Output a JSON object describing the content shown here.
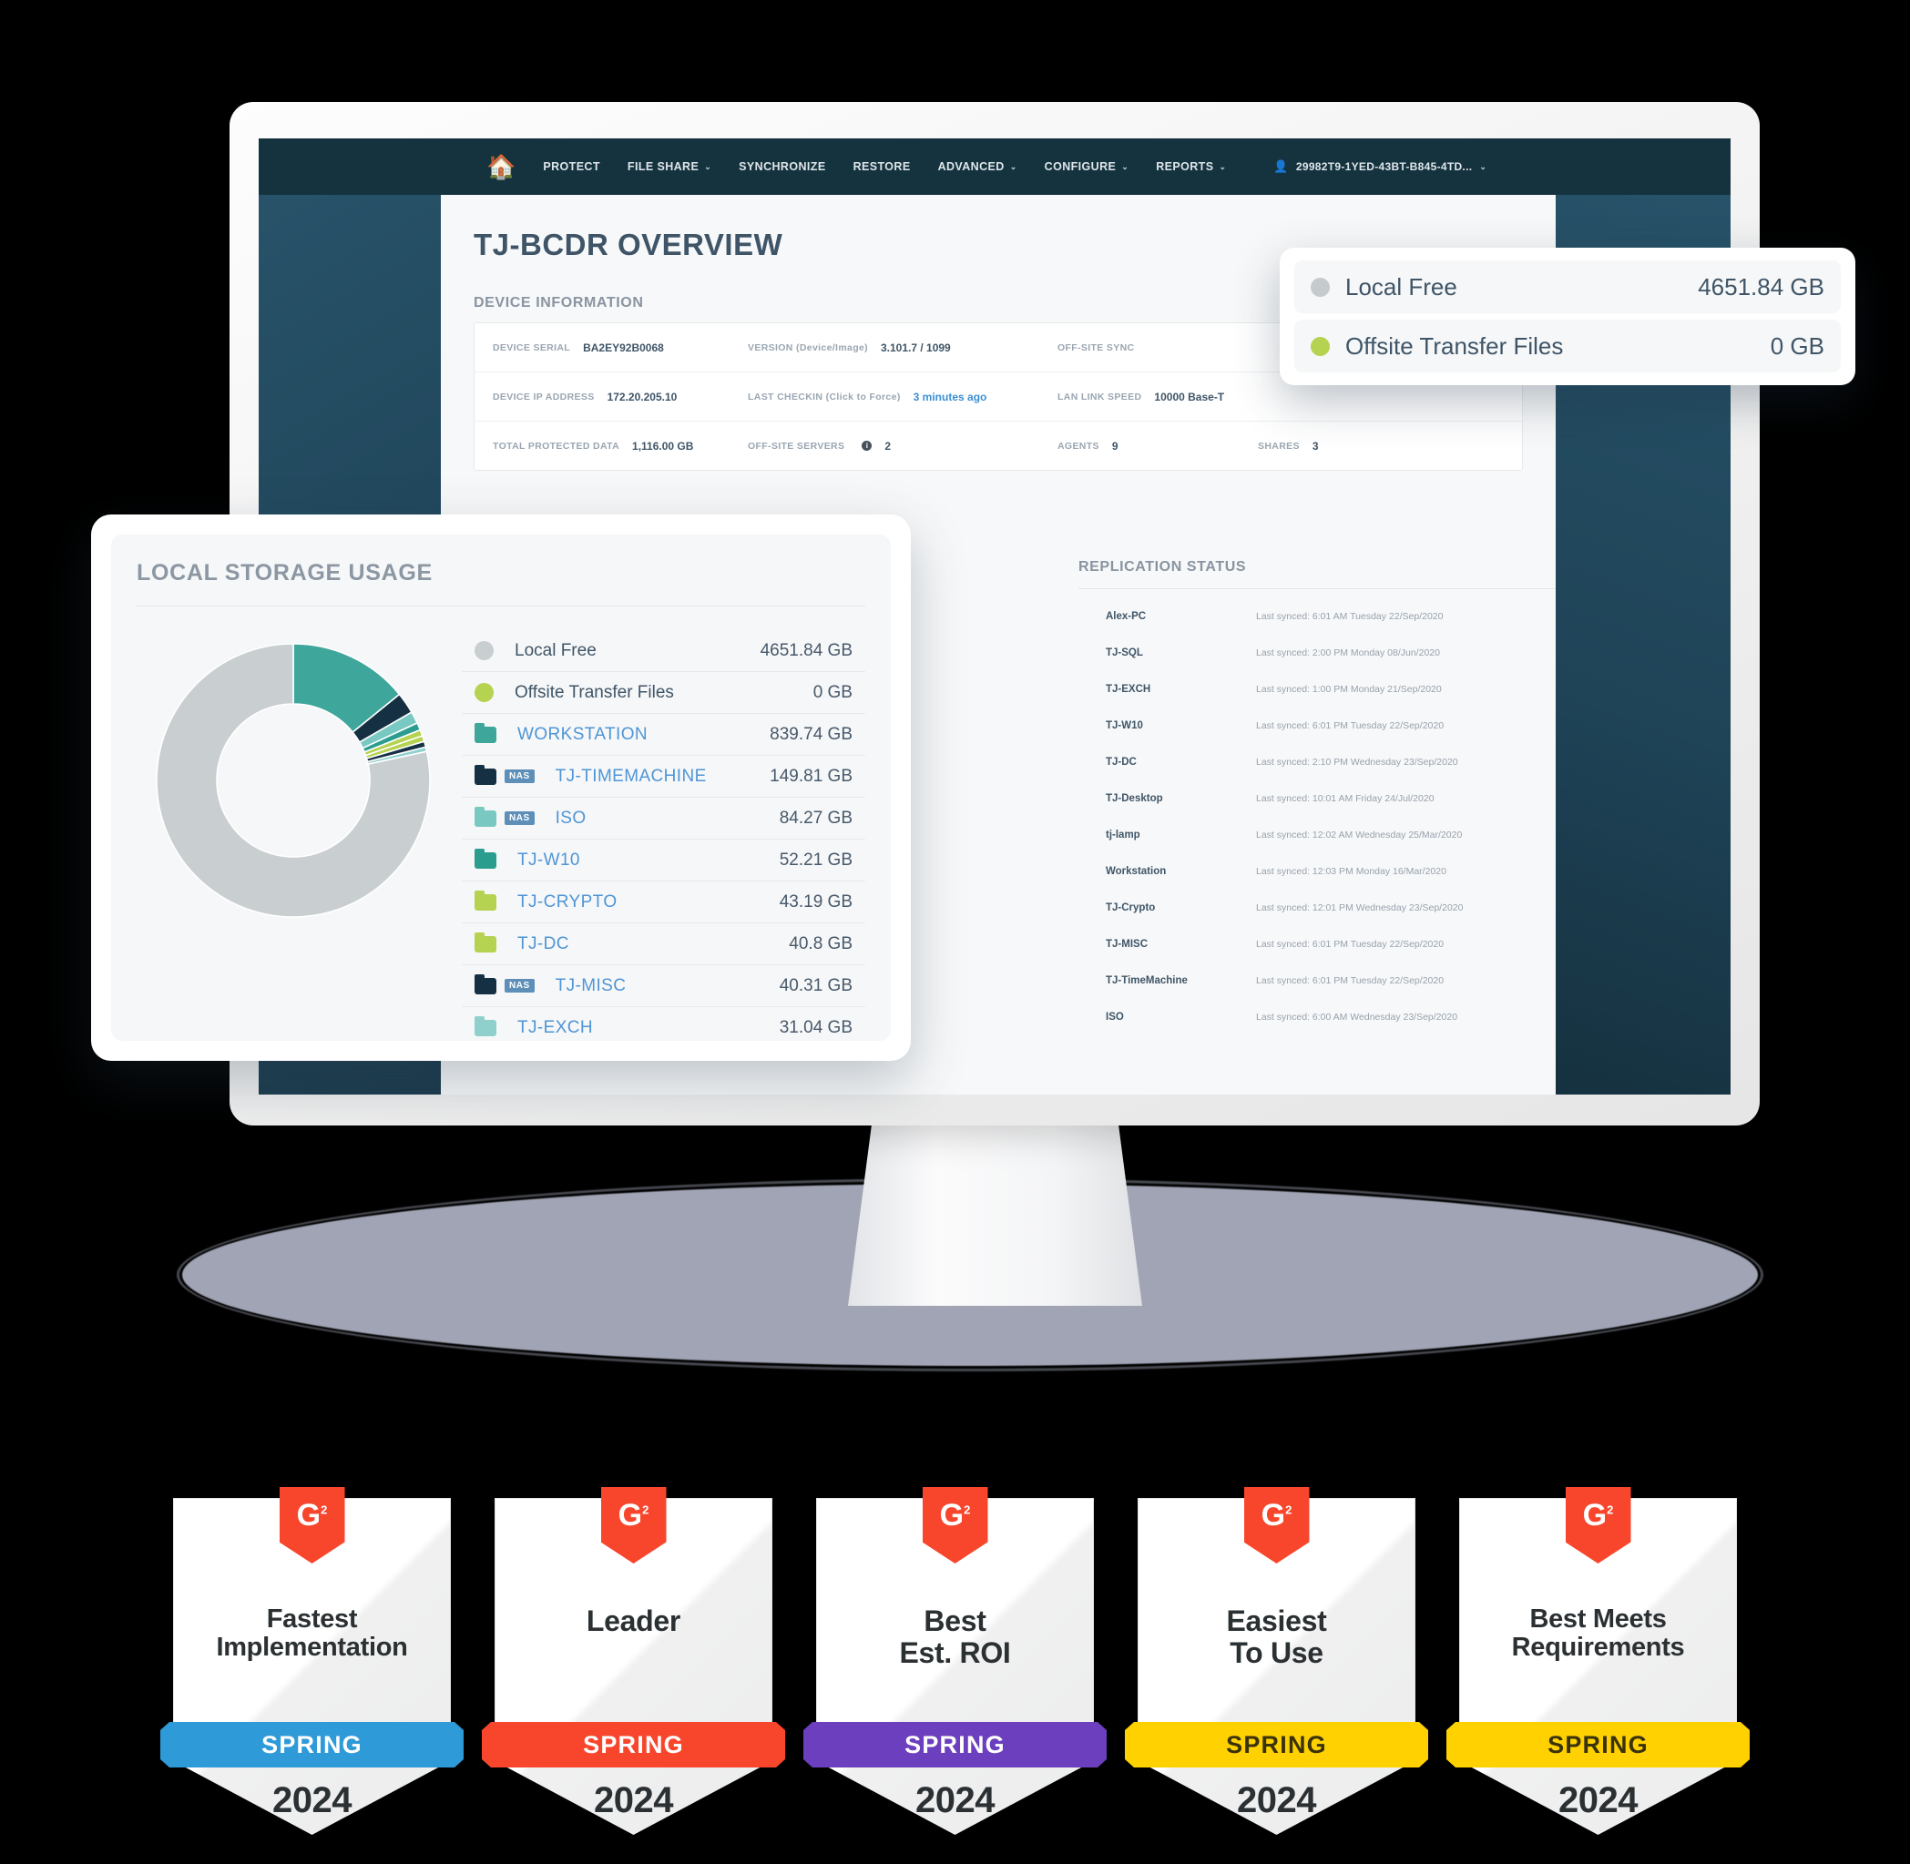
{
  "app": {
    "nav": {
      "home_icon": "home-icon",
      "items": [
        {
          "label": "PROTECT",
          "has_caret": false
        },
        {
          "label": "FILE SHARE",
          "has_caret": true
        },
        {
          "label": "SYNCHRONIZE",
          "has_caret": false
        },
        {
          "label": "RESTORE",
          "has_caret": false
        },
        {
          "label": "ADVANCED",
          "has_caret": true
        },
        {
          "label": "CONFIGURE",
          "has_caret": true
        },
        {
          "label": "REPORTS",
          "has_caret": true
        }
      ],
      "user": "29982T9-1YED-43BT-B845-4TD...",
      "caret_glyph": "⌄",
      "user_glyph": "👤"
    },
    "page_title": "TJ-BCDR OVERVIEW",
    "device_information": {
      "section_label": "DEVICE INFORMATION",
      "rows": [
        [
          {
            "key": "DEVICE SERIAL",
            "value": "BA2EY92B0068",
            "link": false
          },
          {
            "key": "VERSION (Device/Image)",
            "value": "3.101.7 / 1099",
            "link": false
          },
          {
            "key": "OFF-SITE SYNC",
            "value": "",
            "link": false
          }
        ],
        [
          {
            "key": "DEVICE IP ADDRESS",
            "value": "172.20.205.10",
            "link": false
          },
          {
            "key": "LAST CHECKIN (Click to Force)",
            "value": "3 minutes ago",
            "link": true
          },
          {
            "key": "LAN LINK SPEED",
            "value": "10000 Base-T",
            "link": false
          }
        ],
        [
          {
            "key": "TOTAL PROTECTED DATA",
            "value": "1,116.00 GB",
            "link": false
          },
          {
            "key": "OFF-SITE SERVERS",
            "value": "2",
            "link": false,
            "info": true
          },
          {
            "key": "AGENTS",
            "value": "9",
            "link": false
          },
          {
            "key": "SHARES",
            "value": "3",
            "link": false
          }
        ]
      ]
    },
    "replication_status": {
      "title": "REPLICATION STATUS",
      "rows": [
        {
          "name": "Alex-PC",
          "sync": "Last synced: 6:01 AM Tuesday 22/Sep/2020"
        },
        {
          "name": "TJ-SQL",
          "sync": "Last synced: 2:00 PM Monday 08/Jun/2020"
        },
        {
          "name": "TJ-EXCH",
          "sync": "Last synced: 1:00 PM Monday 21/Sep/2020"
        },
        {
          "name": "TJ-W10",
          "sync": "Last synced: 6:01 PM Tuesday 22/Sep/2020"
        },
        {
          "name": "TJ-DC",
          "sync": "Last synced: 2:10 PM Wednesday 23/Sep/2020"
        },
        {
          "name": "TJ-Desktop",
          "sync": "Last synced: 10:01 AM Friday 24/Jul/2020"
        },
        {
          "name": "tj-lamp",
          "sync": "Last synced: 12:02 AM Wednesday 25/Mar/2020"
        },
        {
          "name": "Workstation",
          "sync": "Last synced: 12:03 PM Monday 16/Mar/2020"
        },
        {
          "name": "TJ-Crypto",
          "sync": "Last synced: 12:01 PM Wednesday 23/Sep/2020"
        },
        {
          "name": "TJ-MISC",
          "sync": "Last synced: 6:01 PM Tuesday 22/Sep/2020"
        },
        {
          "name": "TJ-TimeMachine",
          "sync": "Last synced: 6:01 PM Tuesday 22/Sep/2020"
        },
        {
          "name": "ISO",
          "sync": "Last synced: 6:00 AM Wednesday 23/Sep/2020"
        }
      ]
    }
  },
  "storage_card": {
    "title": "LOCAL STORAGE USAGE"
  },
  "tooltip_card": {
    "rows": [
      {
        "label": "Local Free",
        "value": "4651.84 GB",
        "color": "#c5cacd"
      },
      {
        "label": "Offsite Transfer Files",
        "value": "0 GB",
        "color": "#b5d250"
      }
    ]
  },
  "chart_data": {
    "type": "pie",
    "title": "LOCAL STORAGE USAGE",
    "unit": "GB",
    "legend_position": "right",
    "categories": [
      "Local Free",
      "Offsite Transfer Files",
      "WORKSTATION",
      "TJ-TIMEMACHINE",
      "ISO",
      "TJ-W10",
      "TJ-CRYPTO",
      "TJ-DC",
      "TJ-MISC",
      "TJ-EXCH"
    ],
    "values": [
      4651.84,
      0,
      839.74,
      149.81,
      84.27,
      52.21,
      43.19,
      40.8,
      40.31,
      31.04
    ],
    "value_labels": [
      "4651.84 GB",
      "0 GB",
      "839.74 GB",
      "149.81 GB",
      "84.27 GB",
      "52.21 GB",
      "43.19 GB",
      "40.8 GB",
      "40.31 GB",
      "31.04 GB"
    ],
    "colors": [
      "#c9ced1",
      "#b5d250",
      "#3fa69b",
      "#163043",
      "#79c9c2",
      "#2a9d8f",
      "#b5d250",
      "#b5d250",
      "#163043",
      "#8fd0cd"
    ],
    "marker_types": [
      "dot",
      "dot",
      "folder",
      "folder",
      "folder",
      "folder",
      "folder",
      "folder",
      "folder",
      "folder"
    ],
    "nas_flags": [
      false,
      false,
      false,
      true,
      true,
      false,
      false,
      false,
      true,
      false
    ],
    "link_styled": [
      false,
      false,
      true,
      true,
      true,
      true,
      true,
      true,
      true,
      true
    ],
    "nas_badge_text": "NAS"
  },
  "badges": {
    "items": [
      {
        "title": "Fastest\nImplementation",
        "season": "SPRING",
        "year": "2024",
        "ribbon_color": "#2e9ad8",
        "ribbon_text_dark": false,
        "title_small": true
      },
      {
        "title": "Leader",
        "season": "SPRING",
        "year": "2024",
        "ribbon_color": "#f8462c",
        "ribbon_text_dark": false,
        "title_small": false
      },
      {
        "title": "Best\nEst. ROI",
        "season": "SPRING",
        "year": "2024",
        "ribbon_color": "#6b3fbd",
        "ribbon_text_dark": false,
        "title_small": false
      },
      {
        "title": "Easiest\nTo Use",
        "season": "SPRING",
        "year": "2024",
        "ribbon_color": "#ffd100",
        "ribbon_text_dark": true,
        "title_small": false
      },
      {
        "title": "Best Meets\nRequirements",
        "season": "SPRING",
        "year": "2024",
        "ribbon_color": "#ffd100",
        "ribbon_text_dark": true,
        "title_small": true
      }
    ],
    "logo_letter": "G",
    "logo_sup": "2"
  }
}
